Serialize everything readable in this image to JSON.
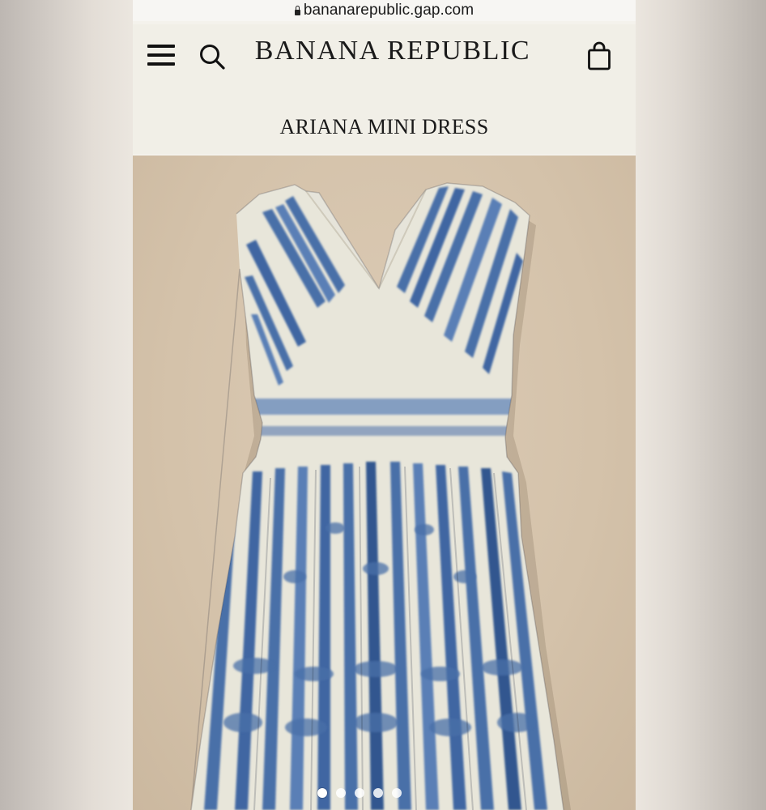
{
  "browser": {
    "url": "bananarepublic.gap.com"
  },
  "header": {
    "brand": "BANANA REPUBLIC",
    "menu_icon": "hamburger-menu-icon",
    "search_icon": "search-icon",
    "bag_icon": "shopping-bag-icon"
  },
  "product": {
    "title": "ARIANA MINI DRESS",
    "image_alt": "Blue and white tie-dye print sleeveless V-neck mini dress with pleated skirt"
  },
  "carousel": {
    "total": 5,
    "active_index": 0
  },
  "colors": {
    "page_bg": "#f1efe7",
    "image_bg": "#d6c4ad",
    "dress_base": "#e7e5d9",
    "print_blue": "#4a6fa8",
    "print_blue_dark": "#33568f"
  }
}
